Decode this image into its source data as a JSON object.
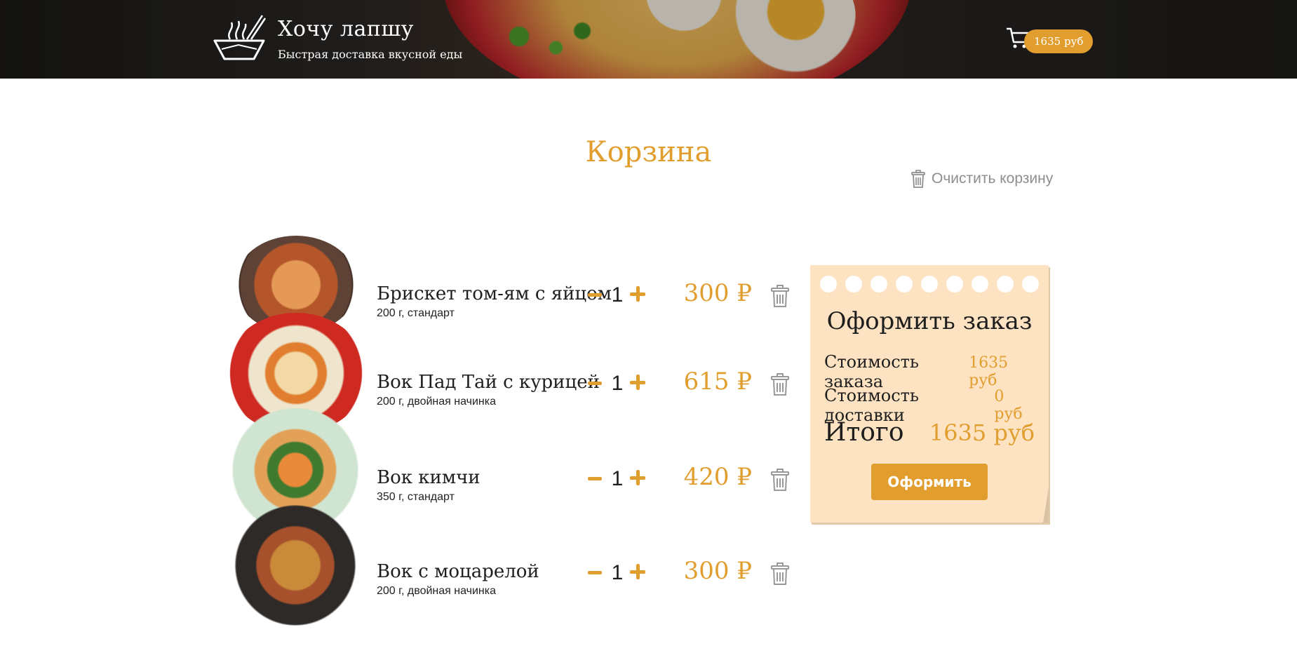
{
  "header": {
    "brand_title": "Хочу лапшу",
    "brand_subtitle": "Быстрая доставка вкусной еды",
    "cart_total": "1635 руб"
  },
  "icons": {
    "logo": "noodle-bowl-icon",
    "cart": "cart-icon",
    "trash": "trash-icon"
  },
  "colors": {
    "accent": "#e19e2e",
    "note_bg": "#fde3c2"
  },
  "page": {
    "title": "Корзина",
    "clear_cart_label": "Очистить корзину"
  },
  "items": [
    {
      "name": "Брискет том-ям с яйцом",
      "desc": "200 г, стандарт",
      "qty": "1",
      "price": "300 ₽"
    },
    {
      "name": "Вок Пад Тай с курицей",
      "desc": "200 г, двойная начинка",
      "qty": "1",
      "price": "615 ₽"
    },
    {
      "name": "Вок кимчи",
      "desc": "350 г, стандарт",
      "qty": "1",
      "price": "420 ₽"
    },
    {
      "name": "Вок с моцарелой",
      "desc": "200 г, двойная начинка",
      "qty": "1",
      "price": "300 ₽"
    }
  ],
  "order": {
    "title": "Оформить заказ",
    "order_cost_label": "Стоимость заказа",
    "order_cost_value": "1635 руб",
    "delivery_cost_label": "Стоимость доставки",
    "delivery_cost_value": "0 руб",
    "total_label": "Итого",
    "total_value": "1635 руб",
    "submit_label": "Оформить"
  }
}
